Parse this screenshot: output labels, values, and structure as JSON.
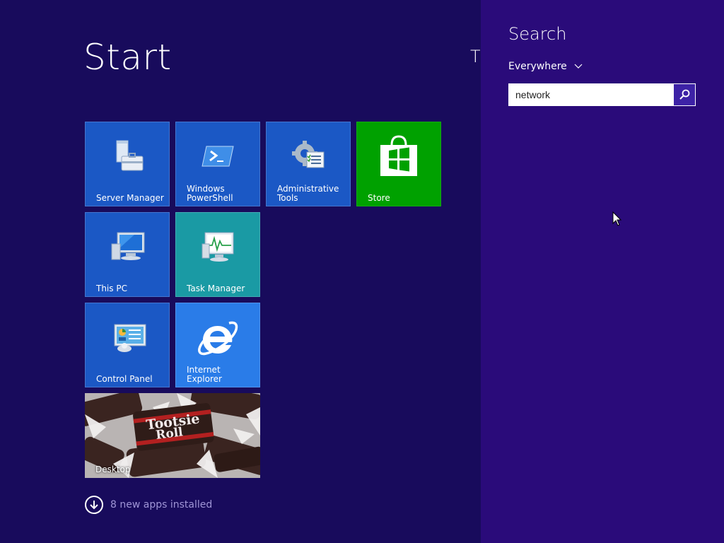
{
  "start": {
    "title": "Start",
    "user_partial": "T"
  },
  "tiles": [
    {
      "label": "Server Manager",
      "icon": "server-manager-icon"
    },
    {
      "label": "Windows PowerShell",
      "icon": "powershell-icon"
    },
    {
      "label": "Administrative Tools",
      "icon": "admin-tools-icon"
    },
    {
      "label": "Store",
      "icon": "store-icon"
    },
    {
      "label": "This PC",
      "icon": "computer-icon"
    },
    {
      "label": "Task Manager",
      "icon": "task-manager-icon"
    },
    {
      "label": "Control Panel",
      "icon": "control-panel-icon"
    },
    {
      "label": "Internet Explorer",
      "icon": "ie-icon"
    },
    {
      "label": "Desktop",
      "icon": "desktop-wallpaper"
    }
  ],
  "desktop_image_text": "Tootsie Roll",
  "apps_installed": {
    "text": "8 new apps installed",
    "icon": "download-circle-icon"
  },
  "search_charm": {
    "title": "Search",
    "scope": "Everywhere",
    "query": "network",
    "button_icon": "search-icon"
  },
  "colors": {
    "background": "#180b5c",
    "charm": "#2a0b7a",
    "tile_blue": "#1b58c5",
    "tile_teal": "#1a9aa4",
    "tile_green": "#00a100",
    "tile_ie": "#2a7ce8"
  }
}
